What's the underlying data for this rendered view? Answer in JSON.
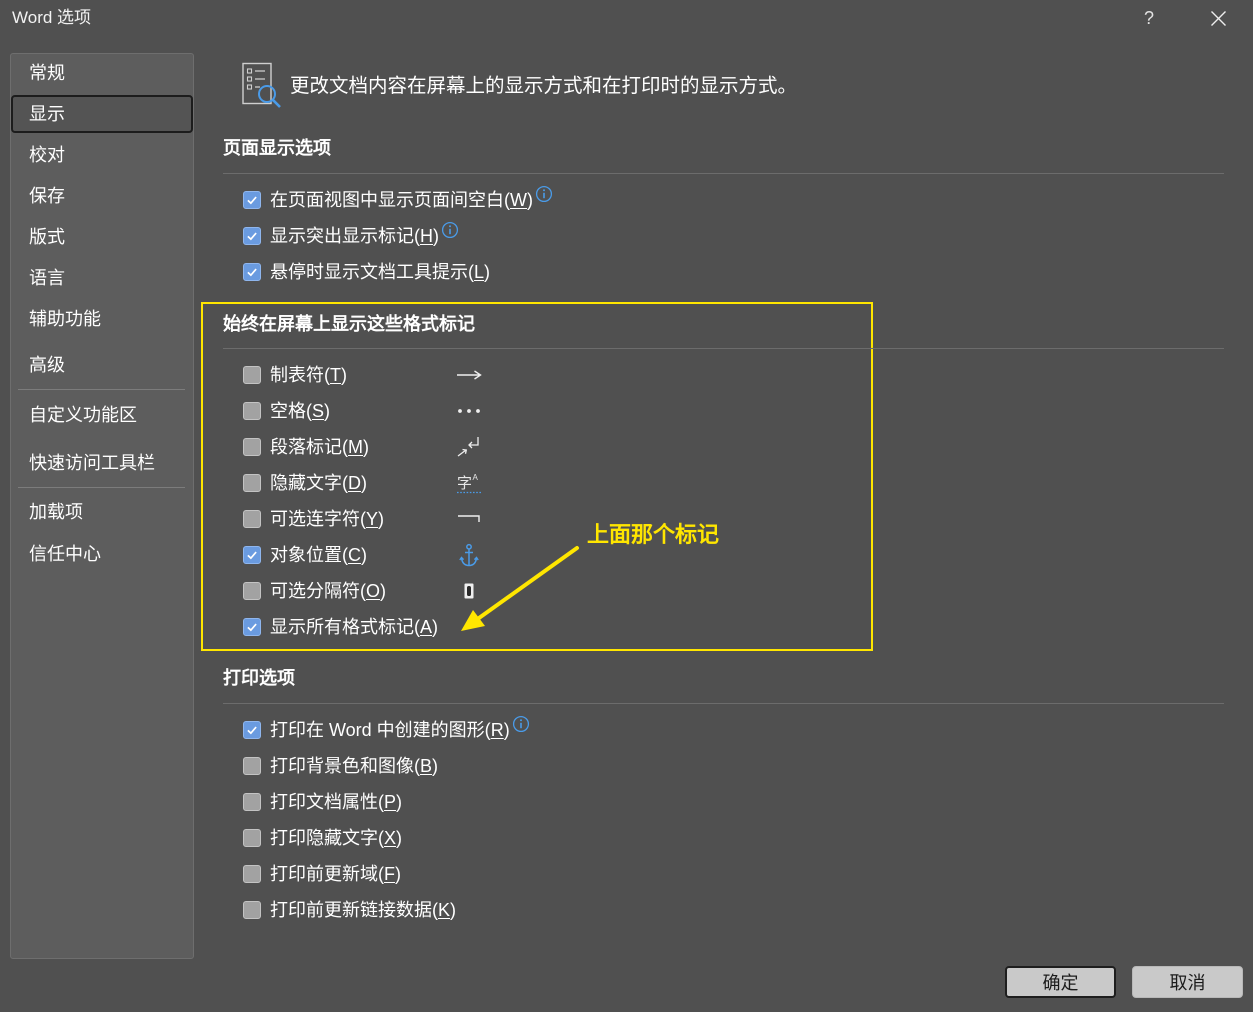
{
  "window": {
    "title": "Word 选项",
    "help_label": "?",
    "close_icon": "close-icon"
  },
  "sidebar": {
    "items": [
      {
        "label": "常规",
        "selected": false
      },
      {
        "label": "显示",
        "selected": true
      },
      {
        "label": "校对",
        "selected": false
      },
      {
        "label": "保存",
        "selected": false
      },
      {
        "label": "版式",
        "selected": false
      },
      {
        "label": "语言",
        "selected": false
      },
      {
        "label": "辅助功能",
        "selected": false
      },
      {
        "label": "高级",
        "selected": false
      },
      {
        "label": "自定义功能区",
        "selected": false
      },
      {
        "label": "快速访问工具栏",
        "selected": false
      },
      {
        "label": "加载项",
        "selected": false
      },
      {
        "label": "信任中心",
        "selected": false
      }
    ]
  },
  "header": {
    "icon": "document-view-icon",
    "text": "更改文档内容在屏幕上的显示方式和在打印时的显示方式。"
  },
  "page_display": {
    "title": "页面显示选项",
    "options": [
      {
        "label": "在页面视图中显示页面间空白(W)",
        "checked": true,
        "info_icon": "info-icon"
      },
      {
        "label": "显示突出显示标记(H)",
        "checked": true,
        "info_icon": "info-icon"
      },
      {
        "label": "悬停时显示文档工具提示(L)",
        "checked": true
      }
    ]
  },
  "format_marks": {
    "title": "始终在屏幕上显示这些格式标记",
    "options": [
      {
        "label": "制表符(T)",
        "checked": false,
        "icon": "tab-arrow-icon"
      },
      {
        "label": "空格(S)",
        "checked": false,
        "icon": "space-dots-icon"
      },
      {
        "label": "段落标记(M)",
        "checked": false,
        "icon": "paragraph-mark-icon"
      },
      {
        "label": "隐藏文字(D)",
        "checked": false,
        "icon": "hidden-text-icon",
        "glyph": "字",
        "glyph_sup": "A"
      },
      {
        "label": "可选连字符(Y)",
        "checked": false,
        "icon": "optional-hyphen-icon"
      },
      {
        "label": "对象位置(C)",
        "checked": true,
        "icon": "anchor-icon"
      },
      {
        "label": "可选分隔符(O)",
        "checked": false,
        "icon": "optional-break-icon"
      },
      {
        "label": "显示所有格式标记(A)",
        "checked": true
      }
    ]
  },
  "print": {
    "title": "打印选项",
    "options": [
      {
        "label": "打印在 Word 中创建的图形(R)",
        "checked": true,
        "info_icon": "info-icon"
      },
      {
        "label": "打印背景色和图像(B)",
        "checked": false
      },
      {
        "label": "打印文档属性(P)",
        "checked": false
      },
      {
        "label": "打印隐藏文字(X)",
        "checked": false
      },
      {
        "label": "打印前更新域(F)",
        "checked": false
      },
      {
        "label": "打印前更新链接数据(K)",
        "checked": false
      }
    ]
  },
  "annotation": {
    "text": "上面那个标记",
    "arrow_icon": "arrow-icon"
  },
  "buttons": {
    "ok": "确定",
    "cancel": "取消"
  },
  "colors": {
    "background": "#505050",
    "sidebar": "#5d5d5d",
    "checkbox_checked": "#6a9be0",
    "info": "#4a9be8",
    "highlight": "#FFE600"
  }
}
